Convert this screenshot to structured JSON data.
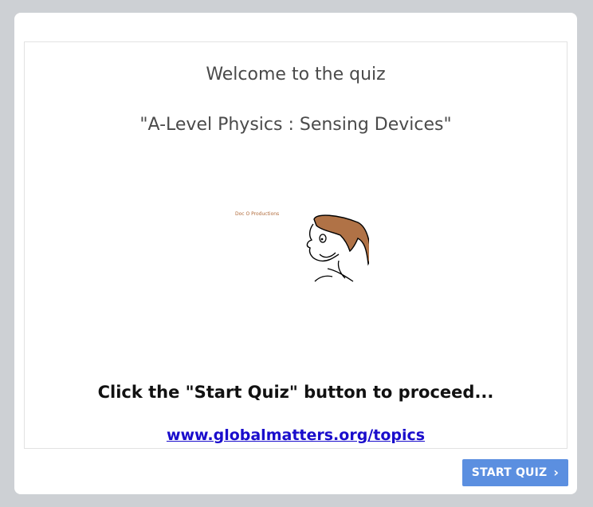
{
  "quiz": {
    "welcome": "Welcome to the quiz",
    "title": "\"A-Level Physics : Sensing Devices\"",
    "logo_text": "Doc O Productions",
    "instruction": "Click the \"Start Quiz\" button to proceed...",
    "link_text": "www.globalmatters.org/topics"
  },
  "footer": {
    "start_label": "START QUIZ",
    "start_icon": "chevron-right-icon"
  },
  "colors": {
    "page_background": "#cdd0d4",
    "button_blue": "#5b8fe0",
    "link_blue": "#1a0dcc",
    "hair_brown": "#b07246"
  }
}
